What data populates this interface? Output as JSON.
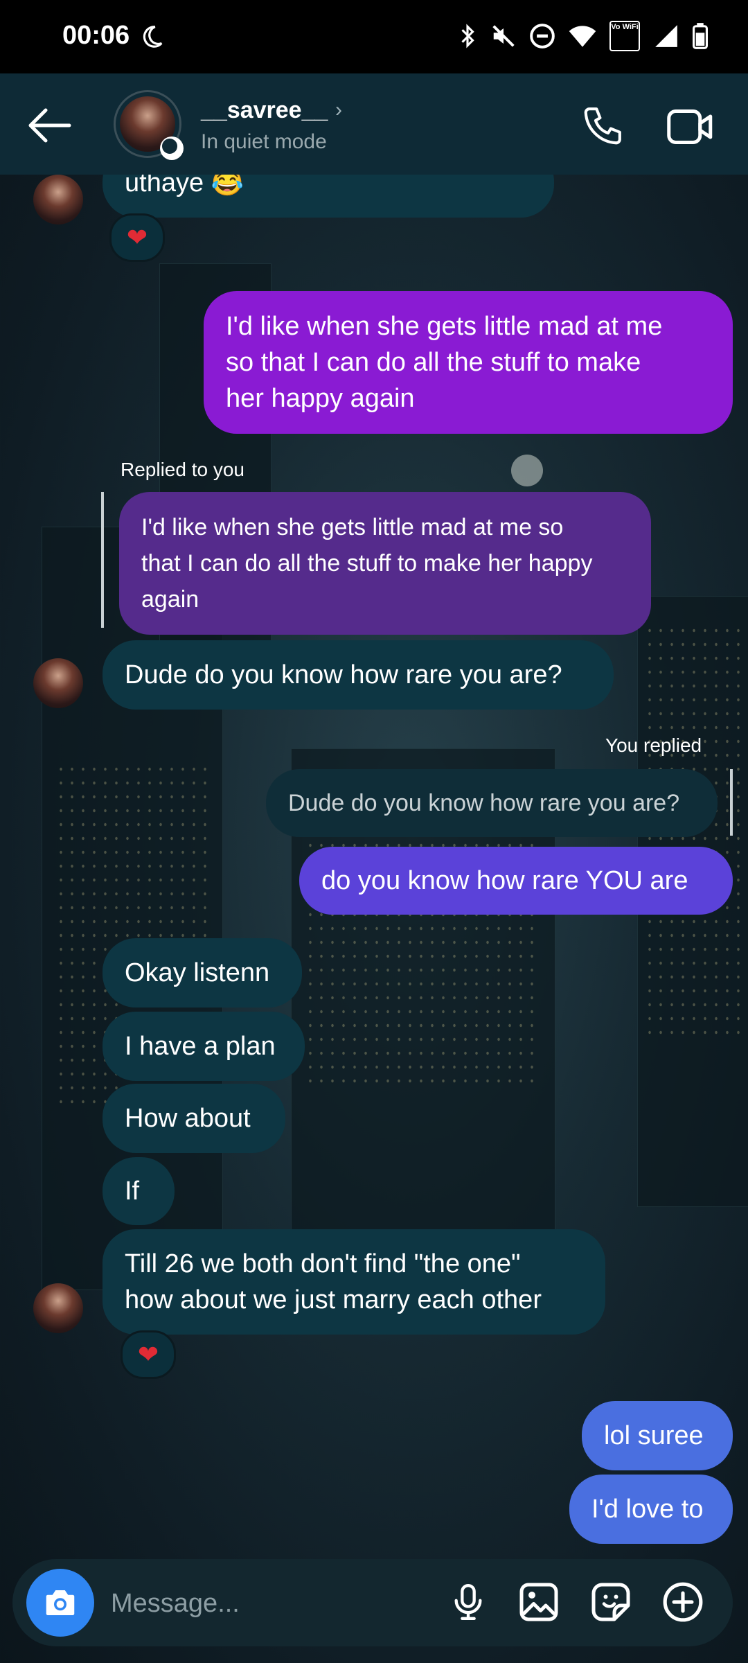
{
  "status_bar": {
    "time": "00:06",
    "vowifi": "Vo WiFi"
  },
  "header": {
    "username": "__savree__",
    "status": "In quiet mode",
    "chevron": "›"
  },
  "messages": {
    "m0": {
      "text": "uthaye 😂",
      "reaction": "❤"
    },
    "m1": {
      "text_lines": [
        "I'd like when she gets little mad at me",
        "so that I can do all the stuff to make",
        "her happy again"
      ]
    },
    "m2": {
      "reply_label": "Replied to you",
      "quote_lines": [
        "I'd like when she gets little mad at me so",
        "that I can do all the stuff to make her happy",
        "again"
      ],
      "text": "Dude do you know how rare you are?"
    },
    "m3": {
      "reply_label": "You replied",
      "quote": "Dude do you know how rare you are?",
      "text": "do you know how rare YOU are"
    },
    "m4": "Okay listenn",
    "m5": "I have a plan",
    "m6": "How about",
    "m7": "If",
    "m8": {
      "text_lines": [
        "Till 26 we both don't find \"the one\"",
        "how about we just marry each other"
      ],
      "reaction": "❤"
    },
    "m9": "lol suree",
    "m10": "I'd love to"
  },
  "composer": {
    "placeholder": "Message..."
  },
  "colors": {
    "incoming": "#0d3643",
    "outgoing_purple": "#8a1bd3",
    "outgoing_violet": "#5b42d9",
    "outgoing_blue": "#4a6fe0",
    "camera_button": "#2f86f3"
  }
}
